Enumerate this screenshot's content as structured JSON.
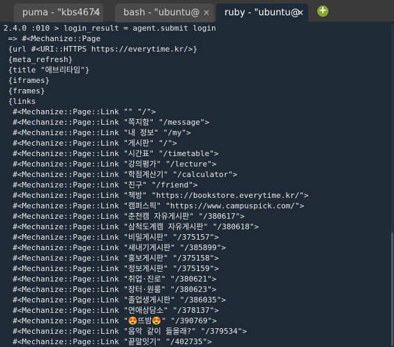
{
  "tabs": [
    {
      "label": "puma - \"kbs4674",
      "close": "×",
      "active": false
    },
    {
      "label": "bash - \"ubuntu@",
      "close": "×",
      "active": false
    },
    {
      "label": "ruby - \"ubuntu@",
      "close": "×",
      "active": true
    }
  ],
  "add_tab_label": "+",
  "terminal": {
    "lines": [
      "2.4.0 :010 > login_result = agent.submit login",
      " => #<Mechanize::Page",
      " {url #<URI::HTTPS https://everytime.kr/>}",
      " {meta_refresh}",
      " {title \"에브리타임\"}",
      " {iframes}",
      " {frames}",
      " {links",
      "  #<Mechanize::Page::Link \"\" \"/\">",
      "  #<Mechanize::Page::Link \"쪽지함\" \"/message\">",
      "  #<Mechanize::Page::Link \"내 정보\" \"/my\">",
      "  #<Mechanize::Page::Link \"게시판\" \"/\">",
      "  #<Mechanize::Page::Link \"시간표\" \"/timetable\">",
      "  #<Mechanize::Page::Link \"강의평가\" \"/lecture\">",
      "  #<Mechanize::Page::Link \"학점계산기\" \"/calculator\">",
      "  #<Mechanize::Page::Link \"친구\" \"/friend\">",
      "  #<Mechanize::Page::Link \"책방\" \"https://bookstore.everytime.kr/\">",
      "  #<Mechanize::Page::Link \"캠퍼스픽\" \"https://www.campuspick.com/\">",
      "  #<Mechanize::Page::Link \"춘천캠 자유게시판\" \"/380617\">",
      "  #<Mechanize::Page::Link \"삼척도계캠 자유게시판\" \"/380618\">",
      "  #<Mechanize::Page::Link \"비밀게시판\" \"/375157\">",
      "  #<Mechanize::Page::Link \"새내기게시판\" \"/385899\">",
      "  #<Mechanize::Page::Link \"홍보게시판\" \"/375158\">",
      "  #<Mechanize::Page::Link \"정보게시판\" \"/375159\">",
      "  #<Mechanize::Page::Link \"취업·진로\" \"/380621\">",
      "  #<Mechanize::Page::Link \"장터·원룸\" \"/380623\">",
      "  #<Mechanize::Page::Link \"졸업생게시판\" \"/386035\">",
      "  #<Mechanize::Page::Link \"연애상담소\" \"/378137\">",
      "  #<Mechanize::Page::Link \"😍뜨밤😍\" \"/390769\">",
      "  #<Mechanize::Page::Link \"음악 같이 들을래?\" \"/379534\">",
      "  #<Mechanize::Page::Link \"끝말잇기\" \"/402735\">"
    ]
  },
  "colors": {
    "terminal_bg": "#1e2a35",
    "tabbar_bg": "#3a3a3a",
    "text": "#e8e8e8",
    "add_button": "#8aa82f"
  },
  "scroll_position": 1.0,
  "scroll_thumb_fraction": 0.35
}
